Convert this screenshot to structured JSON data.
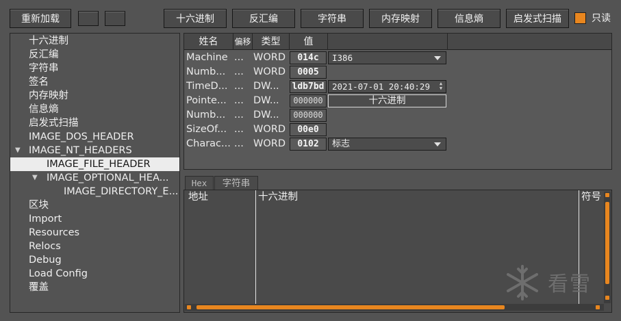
{
  "toolbar": {
    "reload": "重新加载",
    "hex": "十六进制",
    "disasm": "反汇编",
    "strings": "字符串",
    "memmap": "内存映射",
    "entropy": "信息熵",
    "heuristic": "启发式扫描",
    "readonly": "只读"
  },
  "tree": {
    "items": [
      "十六进制",
      "反汇编",
      "字符串",
      "签名",
      "内存映射",
      "信息熵",
      "启发式扫描",
      "IMAGE_DOS_HEADER",
      "IMAGE_NT_HEADERS",
      "IMAGE_FILE_HEADER",
      "IMAGE_OPTIONAL_HEA...",
      "IMAGE_DIRECTORY_E...",
      "区块",
      "Import",
      "Resources",
      "Relocs",
      "Debug",
      "Load Config",
      "覆盖"
    ]
  },
  "header_table": {
    "columns": [
      "姓名",
      "偏移",
      "类型",
      "值"
    ],
    "rows": [
      {
        "name": "Machine",
        "offset": "...",
        "type": "WORD",
        "value": "014c",
        "extra": "I386"
      },
      {
        "name": "Numb...",
        "offset": "...",
        "type": "WORD",
        "value": "0005",
        "extra": ""
      },
      {
        "name": "TimeD...",
        "offset": "...",
        "type": "DW...",
        "value": "ldb7bd",
        "extra": "2021-07-01 20:40:29"
      },
      {
        "name": "Pointe...",
        "offset": "...",
        "type": "DW...",
        "value": "000000",
        "extra": "十六进制"
      },
      {
        "name": "Numb...",
        "offset": "...",
        "type": "DW...",
        "value": "000000",
        "extra": ""
      },
      {
        "name": "SizeOf...",
        "offset": "...",
        "type": "WORD",
        "value": "00e0",
        "extra": ""
      },
      {
        "name": "Charac...",
        "offset": "...",
        "type": "WORD",
        "value": "0102",
        "extra": "标志"
      }
    ]
  },
  "hexview": {
    "tabs": [
      "Hex",
      "字符串"
    ],
    "col_address": "地址",
    "col_hex": "十六进制",
    "col_symbol": "符号"
  },
  "watermark": "看雪",
  "colors": {
    "accent": "#e8861f",
    "background": "#535353",
    "selected": "#ececec"
  }
}
